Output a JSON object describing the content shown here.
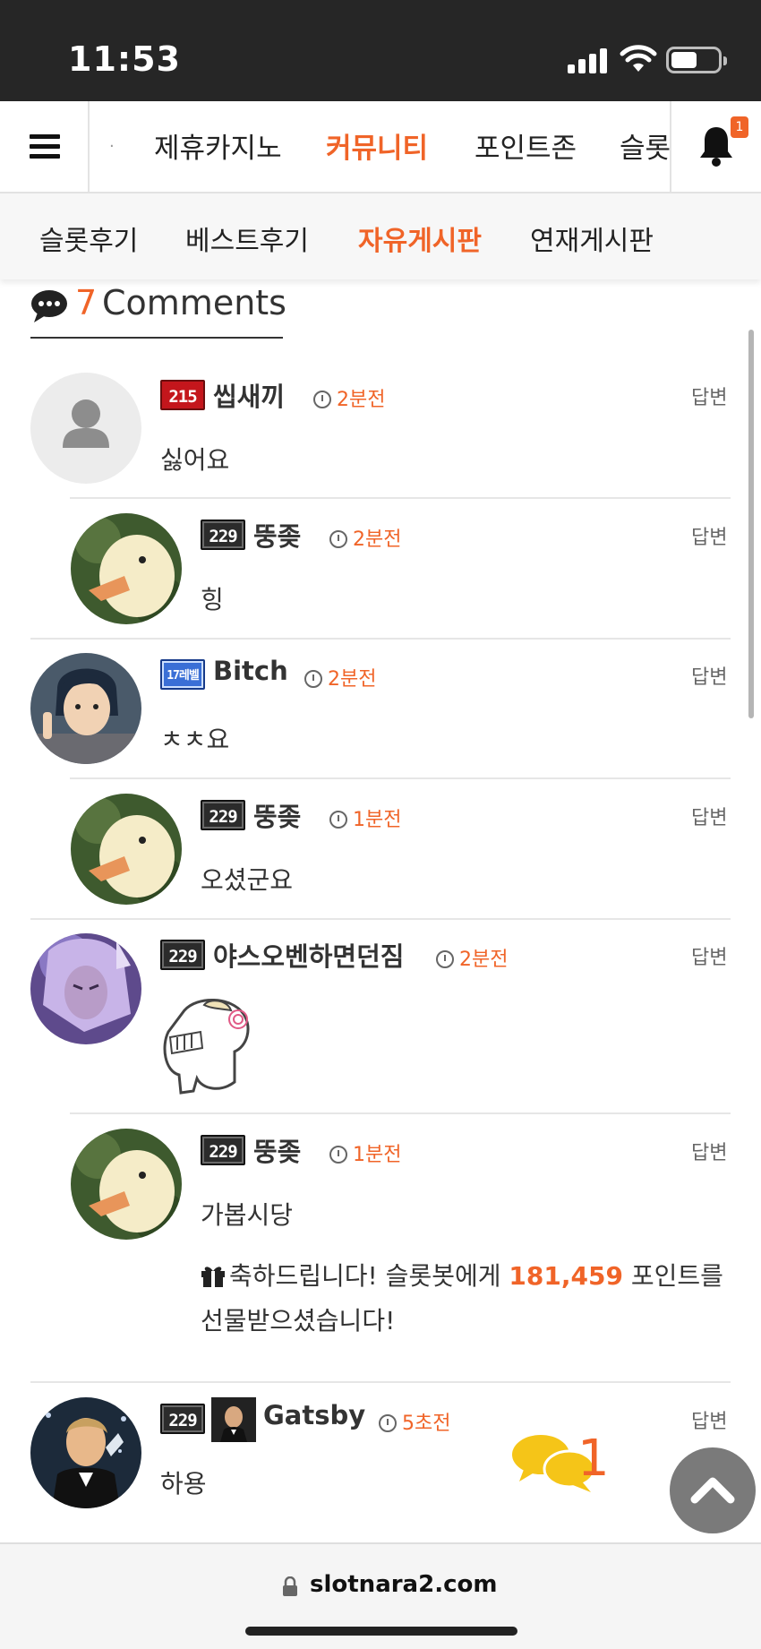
{
  "status_bar": {
    "time": "11:53"
  },
  "top_nav": {
    "items": [
      "제휴카지노",
      "커뮤니티",
      "포인트존",
      "슬롯"
    ],
    "active_index": 1,
    "notification_count": "1"
  },
  "sub_nav": {
    "items": [
      "슬롯후기",
      "베스트후기",
      "자유게시판",
      "연재게시판"
    ],
    "active_index": 2
  },
  "comments_header": {
    "count": "7",
    "label": "Comments"
  },
  "comments": [
    {
      "level": "215",
      "badge": "red",
      "nick": "씹새끼",
      "time": "2분전",
      "reply": "답변",
      "body": "싫어요",
      "avatar": "default-avatar"
    },
    {
      "level": "229",
      "badge": "dark",
      "nick": "뚱좆",
      "time": "2분전",
      "reply": "답변",
      "body": "힝",
      "avatar": "duckling"
    },
    {
      "level": "17레벨",
      "badge": "blue",
      "nick": "Bitch",
      "time": "2분전",
      "reply": "답변",
      "body": "ㅊㅊ요",
      "avatar": "anime-boy"
    },
    {
      "level": "229",
      "badge": "dark",
      "nick": "뚱좆",
      "time": "1분전",
      "reply": "답변",
      "body": "오셨군요",
      "avatar": "duckling"
    },
    {
      "level": "229",
      "badge": "dark",
      "nick": "야스오벤하면던짐",
      "time": "2분전",
      "reply": "답변",
      "body": "",
      "avatar": "purple-character",
      "emoticon": "laughing-emoticon"
    },
    {
      "level": "229",
      "badge": "dark",
      "nick": "뚱좆",
      "time": "1분전",
      "reply": "답변",
      "body": "가봅시당",
      "avatar": "duckling",
      "gift": {
        "prefix": "축하드립니다! 슬롯봇에게 ",
        "points": "181,459",
        "suffix": " 포인트를 선물받으셨습니다!"
      }
    },
    {
      "level": "229",
      "badge": "dark",
      "nick": "Gatsby",
      "time": "5초전",
      "reply": "답변",
      "body": "하용",
      "avatar": "gatsby-toast"
    }
  ],
  "floating": {
    "chat_count": "1"
  },
  "url_bar": {
    "domain": "slotnara2.com"
  },
  "colors": {
    "accent": "#f06428",
    "status_bar": "#262626"
  }
}
